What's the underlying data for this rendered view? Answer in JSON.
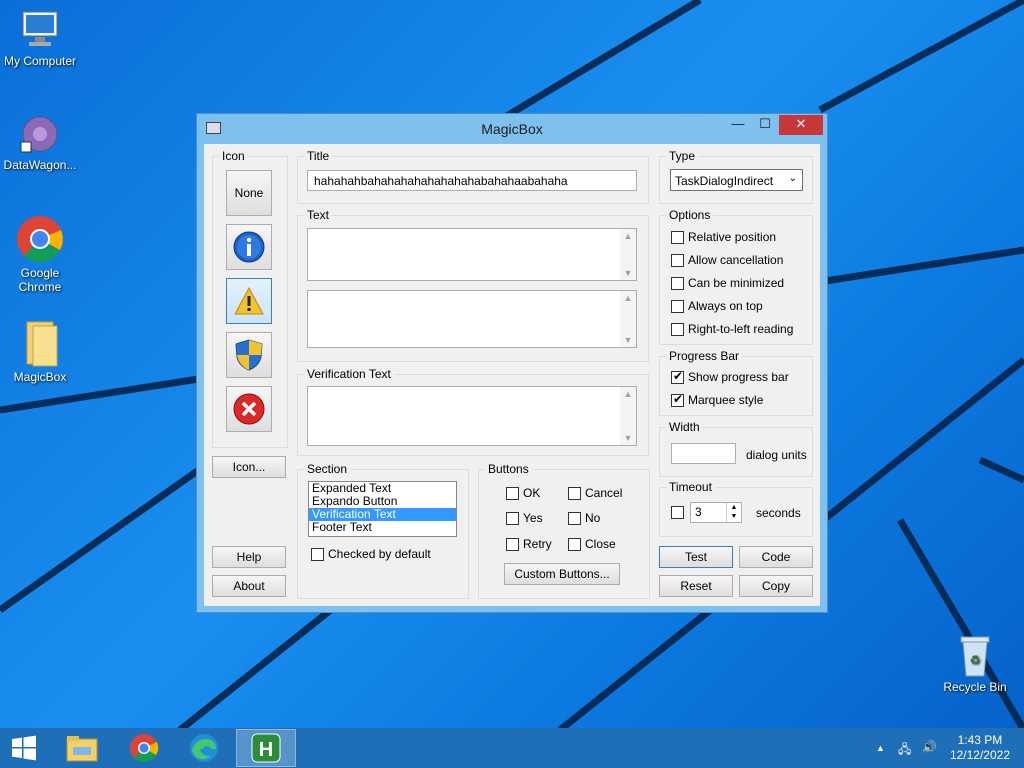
{
  "desktop": {
    "icons": [
      {
        "label": "My Computer"
      },
      {
        "label": "DataWagon..."
      },
      {
        "label": "Google Chrome"
      },
      {
        "label": "MagicBox"
      },
      {
        "label": "Recycle Bin"
      }
    ]
  },
  "window": {
    "title": "MagicBox",
    "icon_group": {
      "label": "Icon",
      "none_label": "None",
      "icon_button_label": "Icon...",
      "help_label": "Help",
      "about_label": "About",
      "icons": [
        "info-icon",
        "warning-icon",
        "shield-icon",
        "error-icon"
      ]
    },
    "title_group": {
      "label": "Title",
      "value": "hahahahbahahahahahahahahabahahaabahaha"
    },
    "text_group": {
      "label": "Text"
    },
    "verification_group": {
      "label": "Verification Text"
    },
    "section_group": {
      "label": "Section",
      "items": [
        "Expanded Text",
        "Expando Button",
        "Verification Text",
        "Footer Text"
      ],
      "selected": "Verification Text",
      "checked_by_default_label": "Checked by default"
    },
    "buttons_group": {
      "label": "Buttons",
      "ok": "OK",
      "cancel": "Cancel",
      "yes": "Yes",
      "no": "No",
      "retry": "Retry",
      "close": "Close",
      "custom_label": "Custom Buttons..."
    },
    "type_group": {
      "label": "Type",
      "value": "TaskDialogIndirect"
    },
    "options_group": {
      "label": "Options",
      "relative_position": "Relative position",
      "allow_cancellation": "Allow cancellation",
      "can_be_minimized": "Can be minimized",
      "always_on_top": "Always on top",
      "rtl_reading": "Right-to-left reading"
    },
    "progress_group": {
      "label": "Progress Bar",
      "show_progress": "Show progress bar",
      "marquee": "Marquee style"
    },
    "width_group": {
      "label": "Width",
      "units": "dialog units",
      "value": ""
    },
    "timeout_group": {
      "label": "Timeout",
      "value": "3",
      "units": "seconds"
    },
    "actions": {
      "test": "Test",
      "code": "Code",
      "reset": "Reset",
      "copy": "Copy"
    }
  },
  "taskbar": {
    "time": "1:43 PM",
    "date": "12/12/2022",
    "apps": [
      "file-explorer-icon",
      "chrome-icon",
      "edge-icon",
      "magicbox-icon"
    ]
  }
}
